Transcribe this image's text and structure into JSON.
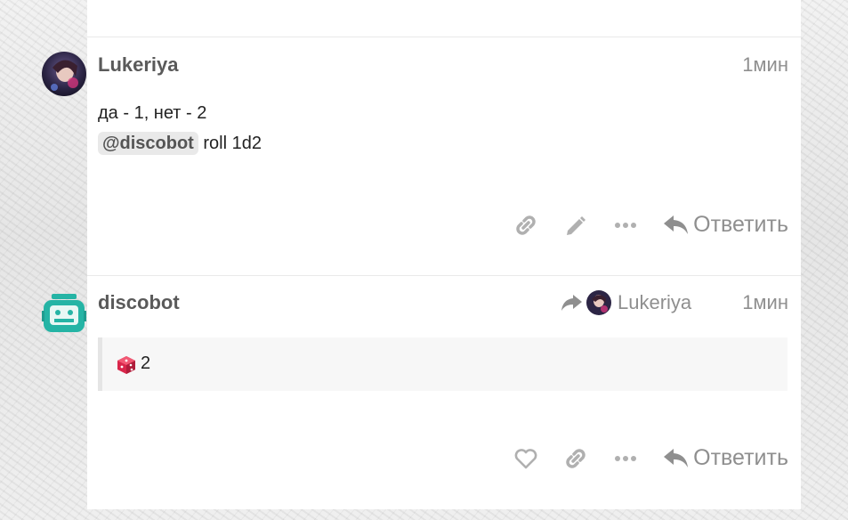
{
  "post1": {
    "username": "Lukeriya",
    "time": "1мин",
    "line1": "да - 1, нет - 2",
    "mention": "@discobot",
    "line2_rest": " roll 1d2",
    "reply_label": "Ответить"
  },
  "post2": {
    "username": "discobot",
    "time": "1мин",
    "reply_to_user": "Lukeriya",
    "dice_result": "2",
    "reply_label": "Ответить"
  },
  "icons": {
    "link": "link-icon",
    "edit": "pencil-icon",
    "more": "ellipsis-icon",
    "reply": "reply-icon",
    "like": "heart-icon",
    "share_reply": "share-arrow-icon",
    "dice": "dice-icon"
  },
  "colors": {
    "text_muted": "#8f8f8f",
    "username": "#5a5a5a",
    "dice": "#d9264a",
    "bot": "#25b4a5"
  }
}
